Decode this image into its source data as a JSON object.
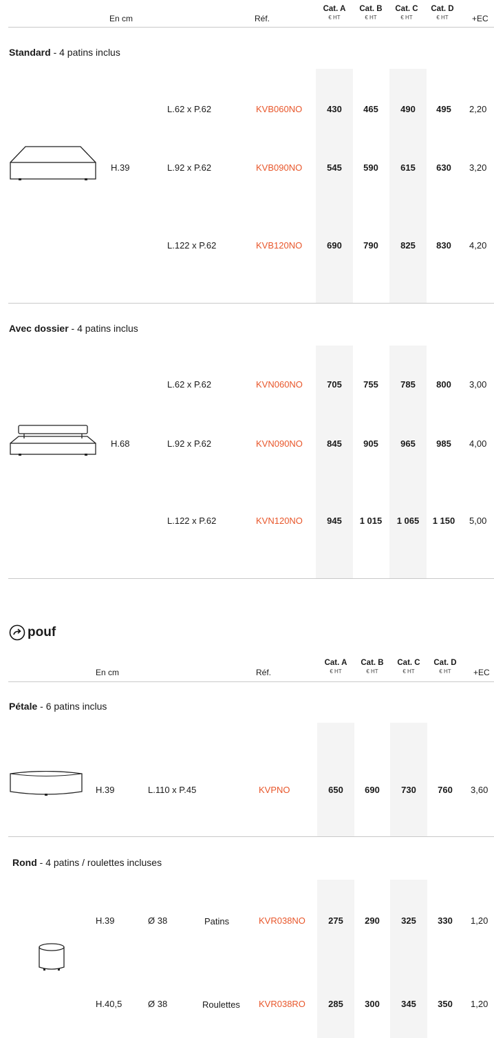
{
  "header": {
    "en_cm": "En cm",
    "ref": "Réf.",
    "cats": [
      {
        "title": "Cat. A",
        "sub": "€ HT"
      },
      {
        "title": "Cat. B",
        "sub": "€ HT"
      },
      {
        "title": "Cat. C",
        "sub": "€ HT"
      },
      {
        "title": "Cat. D",
        "sub": "€ HT"
      }
    ],
    "ec": "+EC"
  },
  "sections": [
    {
      "name": "Standard",
      "suffix": " - 4 patins inclus",
      "height": "H.39",
      "image_icon": "bench-icon",
      "rows": [
        {
          "dim": "L.62 x P.62",
          "ref": "KVB060NO",
          "prices": [
            "430",
            "465",
            "490",
            "495"
          ],
          "ec": "2,20"
        },
        {
          "dim": "L.92 x P.62",
          "ref": "KVB090NO",
          "prices": [
            "545",
            "590",
            "615",
            "630"
          ],
          "ec": "3,20"
        },
        {
          "dim": "L.122 x P.62",
          "ref": "KVB120NO",
          "prices": [
            "690",
            "790",
            "825",
            "830"
          ],
          "ec": "4,20"
        }
      ]
    },
    {
      "name": "Avec dossier",
      "suffix": " - 4 patins inclus",
      "height": "H.68",
      "image_icon": "bench-with-backrest-icon",
      "rows": [
        {
          "dim": "L.62 x P.62",
          "ref": "KVN060NO",
          "prices": [
            "705",
            "755",
            "785",
            "800"
          ],
          "ec": "3,00"
        },
        {
          "dim": "L.92 x P.62",
          "ref": "KVN090NO",
          "prices": [
            "845",
            "905",
            "965",
            "985"
          ],
          "ec": "4,00"
        },
        {
          "dim": "L.122 x P.62",
          "ref": "KVN120NO",
          "prices": [
            "945",
            "1 015",
            "1 065",
            "1 150"
          ],
          "ec": "5,00"
        }
      ]
    }
  ],
  "pouf": {
    "title": "pouf",
    "icon": "arrow-circle-icon",
    "petale": {
      "name": "Pétale",
      "suffix": " - 6 patins inclus",
      "height": "H.39",
      "dim": "L.110 x P.45",
      "ref": "KVPNO",
      "prices": [
        "650",
        "690",
        "730",
        "760"
      ],
      "ec": "3,60"
    },
    "rond": {
      "name": "Rond",
      "suffix": " - 4 patins / roulettes incluses",
      "rows": [
        {
          "height": "H.39",
          "dim": "Ø 38",
          "type": "Patins",
          "ref": "KVR038NO",
          "prices": [
            "275",
            "290",
            "325",
            "330"
          ],
          "ec": "1,20"
        },
        {
          "height": "H.40,5",
          "dim": "Ø 38",
          "type": "Roulettes",
          "ref": "KVR038RO",
          "prices": [
            "285",
            "300",
            "345",
            "350"
          ],
          "ec": "1,20"
        }
      ]
    }
  },
  "colors": {
    "ref": "#e8562a",
    "band": "#f4f4f4",
    "rule": "#c8c8c8"
  }
}
